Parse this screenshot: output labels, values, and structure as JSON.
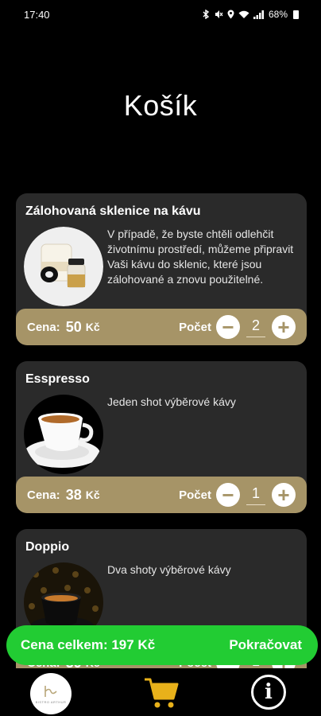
{
  "status_bar": {
    "time": "17:40",
    "icons": [
      "bluetooth-icon",
      "mute-icon",
      "location-icon",
      "wifi-icon",
      "signal-icon"
    ],
    "battery": "68%"
  },
  "page_title": "Košík",
  "products": [
    {
      "title": "Zálohovaná sklenice na kávu",
      "description": "V případě, že byste chtěli odlehčit životnímu prostředí, můžeme připravit Vaši kávu do sklenic, které jsou zálohované a znovu použitelné.",
      "price_label": "Cena:",
      "price": "50",
      "currency": "Kč",
      "qty_label": "Počet",
      "quantity": "2"
    },
    {
      "title": "Esspresso",
      "description": "Jeden shot výběrové kávy",
      "price_label": "Cena:",
      "price": "38",
      "currency": "Kč",
      "qty_label": "Počet",
      "quantity": "1"
    },
    {
      "title": "Doppio",
      "description": "Dva shoty výběrové kávy",
      "price_label": "Cena:",
      "price": "39",
      "currency": "Kč",
      "qty_label": "Počet",
      "quantity": "1"
    }
  ],
  "qty_minus": "−",
  "qty_plus": "+",
  "total": {
    "label": "Cena celkem: 197 Kč",
    "continue": "Pokračovat"
  },
  "nav": {
    "logo_text": "BISTRO ARTHUR",
    "info": "i"
  },
  "colors": {
    "background": "#000000",
    "card": "#2a2a2a",
    "gold": "#a69467",
    "green": "#22cc33"
  }
}
